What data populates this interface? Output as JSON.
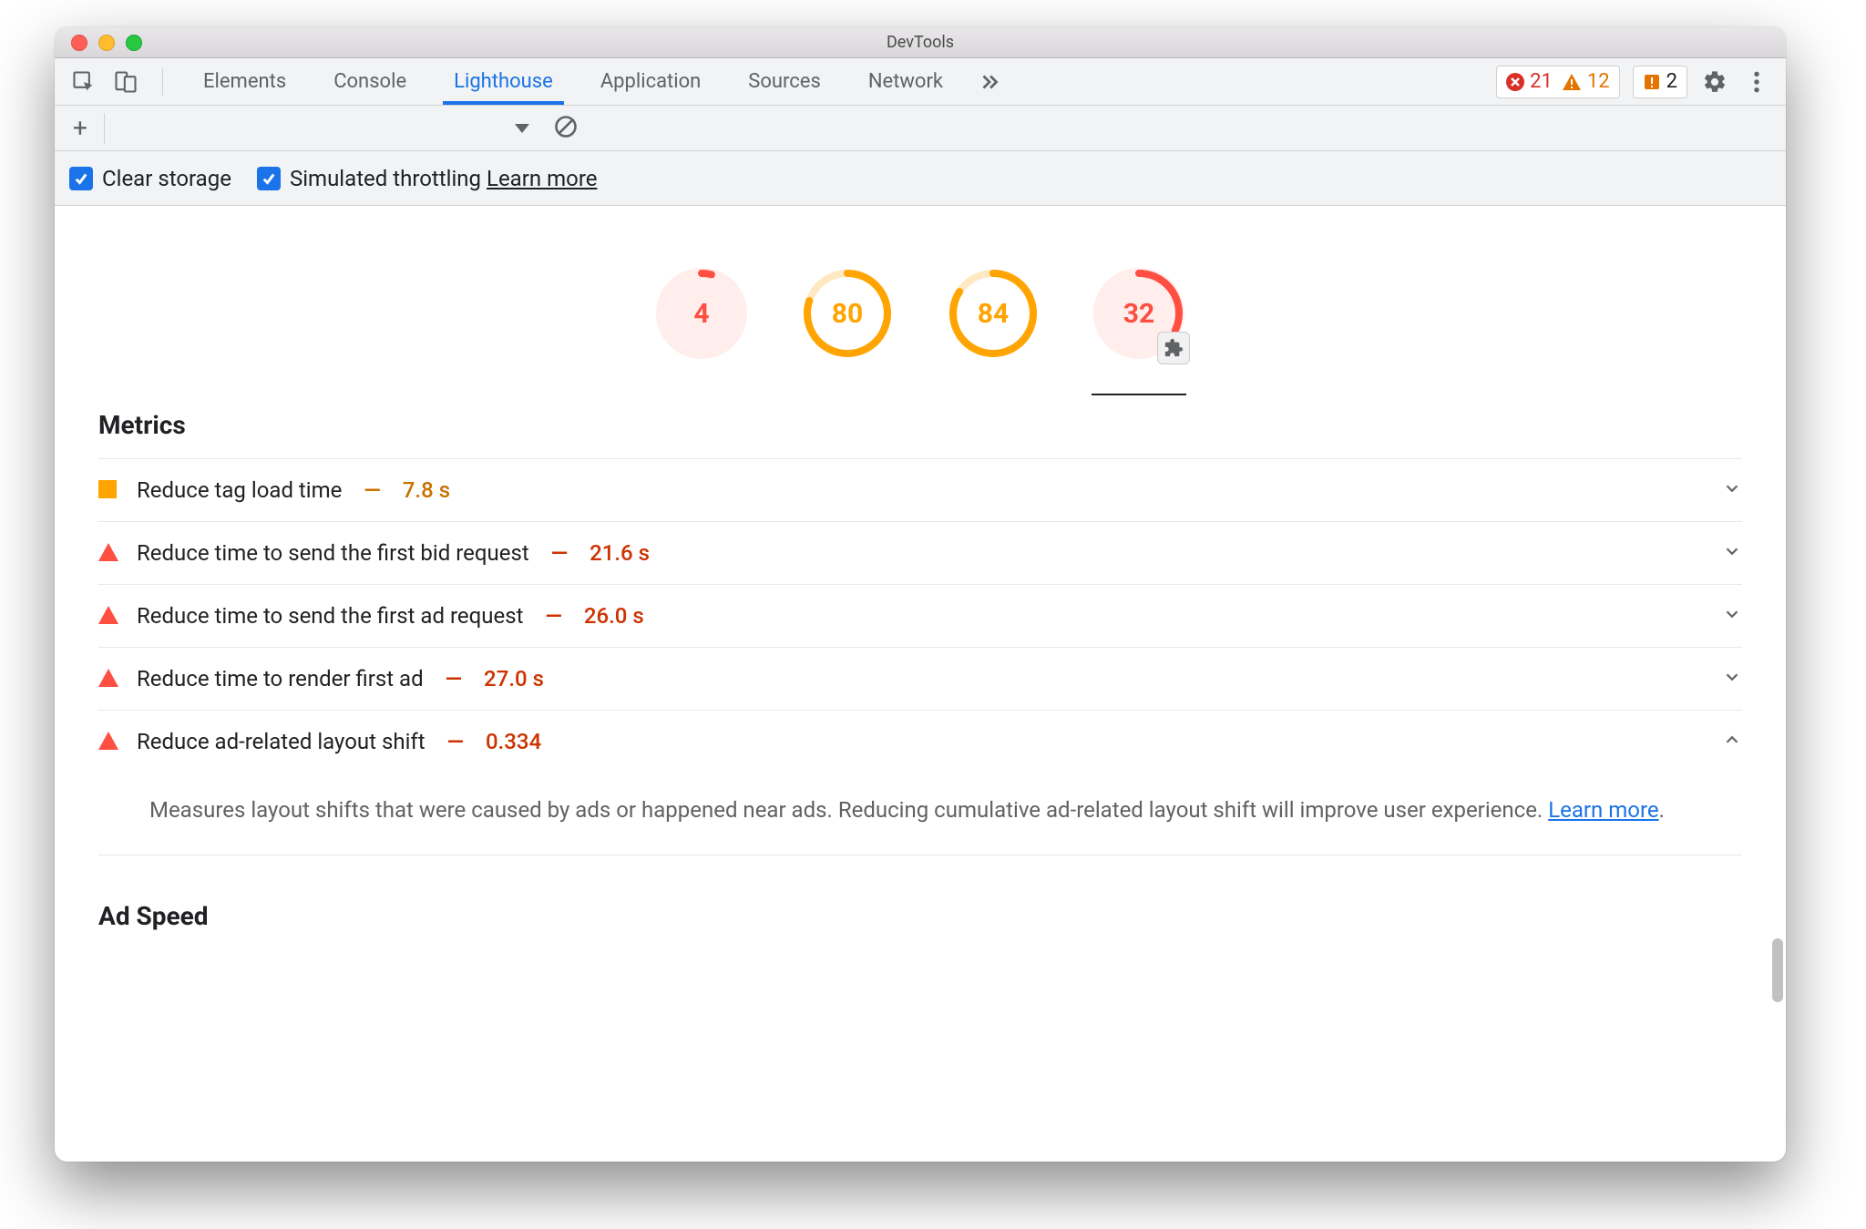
{
  "titlebar": {
    "title": "DevTools"
  },
  "tabs": {
    "items": [
      {
        "label": "Elements"
      },
      {
        "label": "Console"
      },
      {
        "label": "Lighthouse"
      },
      {
        "label": "Application"
      },
      {
        "label": "Sources"
      },
      {
        "label": "Network"
      }
    ],
    "activeIndex": 2
  },
  "counters": {
    "errors": "21",
    "warnings": "12",
    "issues": "2"
  },
  "options": {
    "clearStorage": "Clear storage",
    "simThrottling": "Simulated throttling",
    "learnMore": "Learn more"
  },
  "scores": [
    {
      "value": "4",
      "level": "red",
      "pct": 4,
      "badge": false
    },
    {
      "value": "80",
      "level": "orange",
      "pct": 80,
      "badge": false
    },
    {
      "value": "84",
      "level": "orange",
      "pct": 84,
      "badge": false
    },
    {
      "value": "32",
      "level": "red",
      "pct": 32,
      "badge": true,
      "selected": true
    }
  ],
  "sections": {
    "metricsTitle": "Metrics",
    "adSpeedTitle": "Ad Speed"
  },
  "metrics": [
    {
      "icon": "square-orange",
      "label": "Reduce tag load time",
      "value": "7.8 s",
      "color": "orange",
      "expanded": false
    },
    {
      "icon": "triangle-red",
      "label": "Reduce time to send the first bid request",
      "value": "21.6 s",
      "color": "red",
      "expanded": false
    },
    {
      "icon": "triangle-red",
      "label": "Reduce time to send the first ad request",
      "value": "26.0 s",
      "color": "red",
      "expanded": false
    },
    {
      "icon": "triangle-red",
      "label": "Reduce time to render first ad",
      "value": "27.0 s",
      "color": "red",
      "expanded": false
    },
    {
      "icon": "triangle-red",
      "label": "Reduce ad-related layout shift",
      "value": "0.334",
      "color": "red",
      "expanded": true,
      "description": "Measures layout shifts that were caused by ads or happened near ads. Reducing cumulative ad-related layout shift will improve user experience. ",
      "learnMore": "Learn more"
    }
  ]
}
